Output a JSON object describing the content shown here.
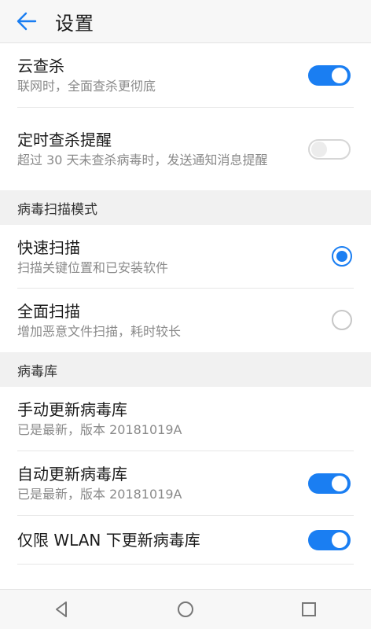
{
  "header": {
    "title": "设置",
    "back_icon": "back-arrow-icon"
  },
  "colors": {
    "accent": "#1a7ef2",
    "section_bg": "#f1f1f1",
    "subtitle": "#8a8a8a"
  },
  "items": {
    "cloud_scan": {
      "title": "云查杀",
      "subtitle": "联网时，全面查杀更彻底",
      "enabled": true
    },
    "scheduled_reminder": {
      "title": "定时查杀提醒",
      "subtitle": "超过 30 天未查杀病毒时，发送通知消息提醒",
      "enabled": false
    }
  },
  "scan_mode": {
    "header": "病毒扫描模式",
    "options": [
      {
        "title": "快速扫描",
        "subtitle": "扫描关键位置和已安装软件",
        "selected": true
      },
      {
        "title": "全面扫描",
        "subtitle": "增加恶意文件扫描，耗时较长",
        "selected": false
      }
    ]
  },
  "virus_db": {
    "header": "病毒库",
    "manual_update": {
      "title": "手动更新病毒库",
      "subtitle": "已是最新，版本 20181019A"
    },
    "auto_update": {
      "title": "自动更新病毒库",
      "subtitle": "已是最新，版本 20181019A",
      "enabled": true
    },
    "wlan_only": {
      "title": "仅限 WLAN 下更新病毒库",
      "enabled": true
    }
  },
  "nav": {
    "back_icon": "nav-back-triangle-icon",
    "home_icon": "nav-home-circle-icon",
    "recents_icon": "nav-recents-square-icon"
  }
}
